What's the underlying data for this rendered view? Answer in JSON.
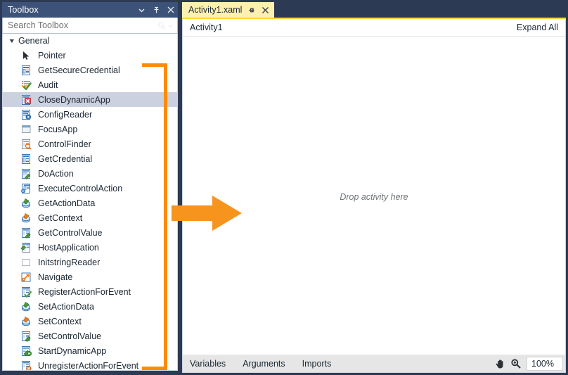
{
  "toolbox": {
    "title": "Toolbox",
    "header_buttons": [
      {
        "name": "dropdown",
        "icon": "chevron-down-icon"
      },
      {
        "name": "pin",
        "icon": "pin-icon"
      },
      {
        "name": "close",
        "icon": "close-icon"
      }
    ],
    "search": {
      "placeholder": "Search Toolbox",
      "icon": "search-icon",
      "dropdown_icon": "chevron-down-icon"
    },
    "category": {
      "label": "General",
      "expanded": true
    },
    "items": [
      {
        "label": "Pointer",
        "icon": "pointer-icon",
        "selected": false
      },
      {
        "label": "GetSecureCredential",
        "icon": "form-blue-icon",
        "selected": false
      },
      {
        "label": "Audit",
        "icon": "list-check-icon",
        "selected": false
      },
      {
        "label": "CloseDynamicApp",
        "icon": "window-close-red-icon",
        "selected": true
      },
      {
        "label": "ConfigReader",
        "icon": "doc-gear-icon",
        "selected": false
      },
      {
        "label": "FocusApp",
        "icon": "window-blue-icon",
        "selected": false
      },
      {
        "label": "ControlFinder",
        "icon": "doc-find-icon",
        "selected": false
      },
      {
        "label": "GetCredential",
        "icon": "form-blue-icon",
        "selected": false
      },
      {
        "label": "DoAction",
        "icon": "doc-action-icon",
        "selected": false
      },
      {
        "label": "ExecuteControlAction",
        "icon": "exec-control-icon",
        "selected": false
      },
      {
        "label": "GetActionData",
        "icon": "data-green-icon",
        "selected": false
      },
      {
        "label": "GetContext",
        "icon": "data-orange-icon",
        "selected": false
      },
      {
        "label": "GetControlValue",
        "icon": "doc-green-icon",
        "selected": false
      },
      {
        "label": "HostApplication",
        "icon": "window-green-icon",
        "selected": false
      },
      {
        "label": "InitstringReader",
        "icon": "blank-doc-icon",
        "selected": false
      },
      {
        "label": "Navigate",
        "icon": "navigate-icon",
        "selected": false
      },
      {
        "label": "RegisterActionForEvent",
        "icon": "doc-check-icon",
        "selected": false
      },
      {
        "label": "SetActionData",
        "icon": "data-green-icon",
        "selected": false
      },
      {
        "label": "SetContext",
        "icon": "data-orange-icon",
        "selected": false
      },
      {
        "label": "SetControlValue",
        "icon": "doc-green-icon",
        "selected": false
      },
      {
        "label": "StartDynamicApp",
        "icon": "doc-play-icon",
        "selected": false
      },
      {
        "label": "UnregisterActionForEvent",
        "icon": "doc-remove-icon",
        "selected": false
      }
    ]
  },
  "designer": {
    "tab": {
      "title": "Activity1.xaml",
      "pin_icon": "pin-icon",
      "close_icon": "close-icon"
    },
    "breadcrumb": "Activity1",
    "expand_all": "Expand All",
    "canvas": {
      "drop_hint": "Drop activity here"
    },
    "footer": {
      "items": [
        "Variables",
        "Arguments",
        "Imports"
      ],
      "pan_icon": "hand-icon",
      "zoom_icon": "magnifier-icon",
      "zoom_level": "100%"
    }
  },
  "annotation": {
    "bracket_color": "#ff8c00",
    "arrow_color": "#f7941e",
    "arrow_name": "orange-arrow-annotation"
  }
}
